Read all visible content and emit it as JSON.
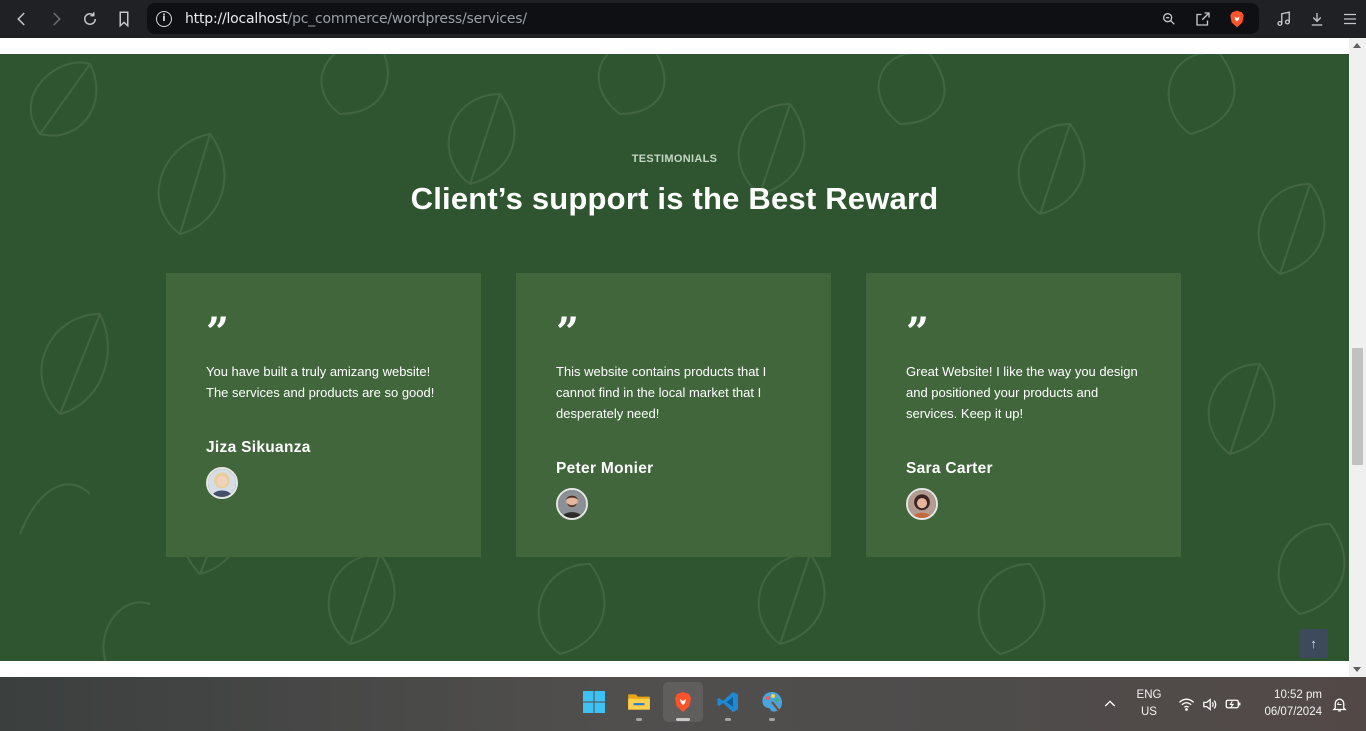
{
  "browser": {
    "url_host": "http://localhost",
    "url_path": "/pc_commerce/wordpress/services/"
  },
  "testimonials": {
    "eyebrow": "TESTIMONIALS",
    "heading": "Client’s support is the Best Reward",
    "quote_glyph": "”",
    "cards": [
      {
        "text": "You have built a truly amizang website! The services and products are so good!",
        "name": "Jiza Sikuanza",
        "avatar": "woman-blonde-avatar"
      },
      {
        "text": "This website contains products that I cannot find in the local market that I desperately need!",
        "name": "Peter Monier",
        "avatar": "man-beard-avatar"
      },
      {
        "text": "Great Website! I like the way you design and positioned your products and services. Keep it up!",
        "name": "Sara Carter",
        "avatar": "woman-dark-hair-avatar"
      }
    ],
    "colors": {
      "section_bg": "#2f5530",
      "card_bg": "#41663c"
    }
  },
  "scroll_top": {
    "icon": "arrow-up-icon",
    "glyph": "↑"
  },
  "taskbar": {
    "apps": [
      "windows-start",
      "file-explorer",
      "brave-browser",
      "vs-code",
      "paint"
    ],
    "lang_top": "ENG",
    "lang_bottom": "US",
    "time": "10:52 pm",
    "date": "06/07/2024"
  }
}
